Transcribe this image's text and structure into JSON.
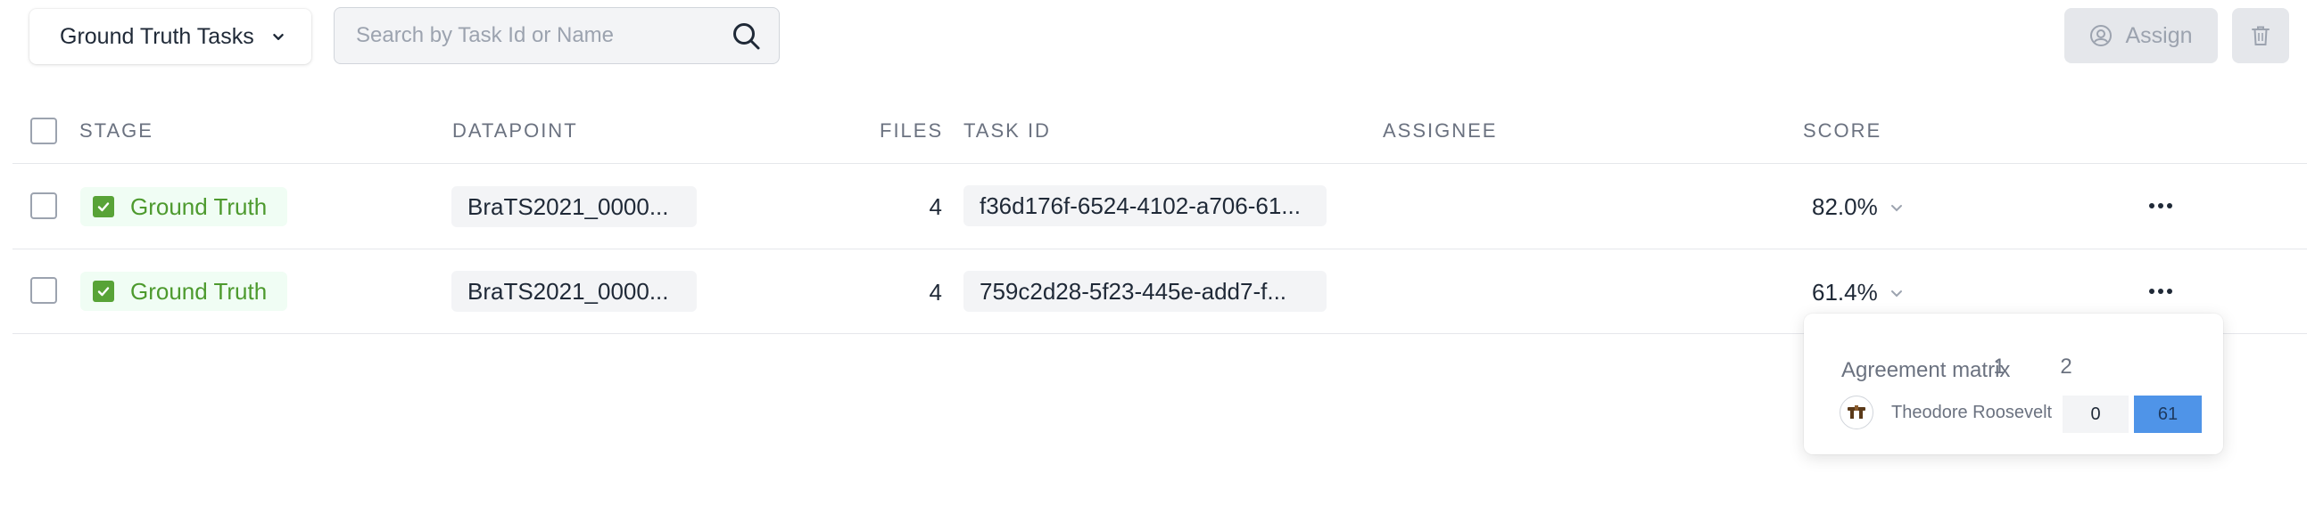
{
  "toolbar": {
    "filter_label": "Ground Truth Tasks",
    "search_placeholder": "Search by Task Id or Name",
    "assign_label": "Assign"
  },
  "table": {
    "headers": {
      "stage": "STAGE",
      "datapoint": "DATAPOINT",
      "files": "FILES",
      "task_id": "TASK ID",
      "assignee": "ASSIGNEE",
      "score": "SCORE"
    },
    "rows": [
      {
        "stage": "Ground Truth",
        "datapoint": "BraTS2021_0000...",
        "files": "4",
        "task_id": "f36d176f-6524-4102-a706-61...",
        "assignee": "",
        "score": "82.0%"
      },
      {
        "stage": "Ground Truth",
        "datapoint": "BraTS2021_0000...",
        "files": "4",
        "task_id": "759c2d28-5f23-445e-add7-f...",
        "assignee": "",
        "score": "61.4%"
      }
    ]
  },
  "agreement_popover": {
    "title": "Agreement matrix",
    "columns": [
      "1",
      "2"
    ],
    "rows": [
      {
        "name": "Theodore Roosevelt",
        "values": [
          "0",
          "61"
        ]
      }
    ]
  },
  "colors": {
    "stage_text": "#4d9a2e",
    "stage_bg": "#f0fdf4",
    "stage_check": "#58a337",
    "matrix_highlight": "#4f94e8"
  },
  "icons": {
    "dropdown": "chevron-down-icon",
    "search": "search-icon",
    "assign": "user-circle-icon",
    "delete": "trash-icon",
    "score_toggle": "chevron-down-icon",
    "row_menu": "more-horizontal-icon",
    "stage": "checkbox-checked-icon"
  }
}
